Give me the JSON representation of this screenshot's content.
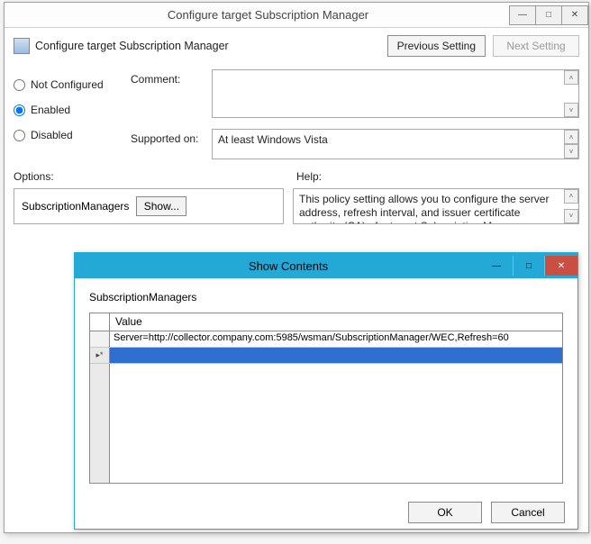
{
  "parent_window": {
    "title": "Configure target Subscription Manager",
    "header_label": "Configure target Subscription Manager",
    "previous_setting": "Previous Setting",
    "next_setting": "Next Setting",
    "radios": {
      "not_configured": "Not Configured",
      "enabled": "Enabled",
      "disabled": "Disabled",
      "selected": "enabled"
    },
    "comment_label": "Comment:",
    "comment_value": "",
    "supported_label": "Supported on:",
    "supported_value": "At least Windows Vista",
    "options_label": "Options:",
    "help_label": "Help:",
    "options_field_label": "SubscriptionManagers",
    "show_button": "Show...",
    "help_text": "This policy setting allows you to configure the server address, refresh interval, and issuer certificate authority (CA) of a target Subscription Manager."
  },
  "child_dialog": {
    "title": "Show Contents",
    "list_label": "SubscriptionManagers",
    "column_header": "Value",
    "rows": [
      "Server=http://collector.company.com:5985/wsman/SubscriptionManager/WEC,Refresh=60",
      ""
    ],
    "selected_row_index": 1,
    "ok": "OK",
    "cancel": "Cancel"
  }
}
